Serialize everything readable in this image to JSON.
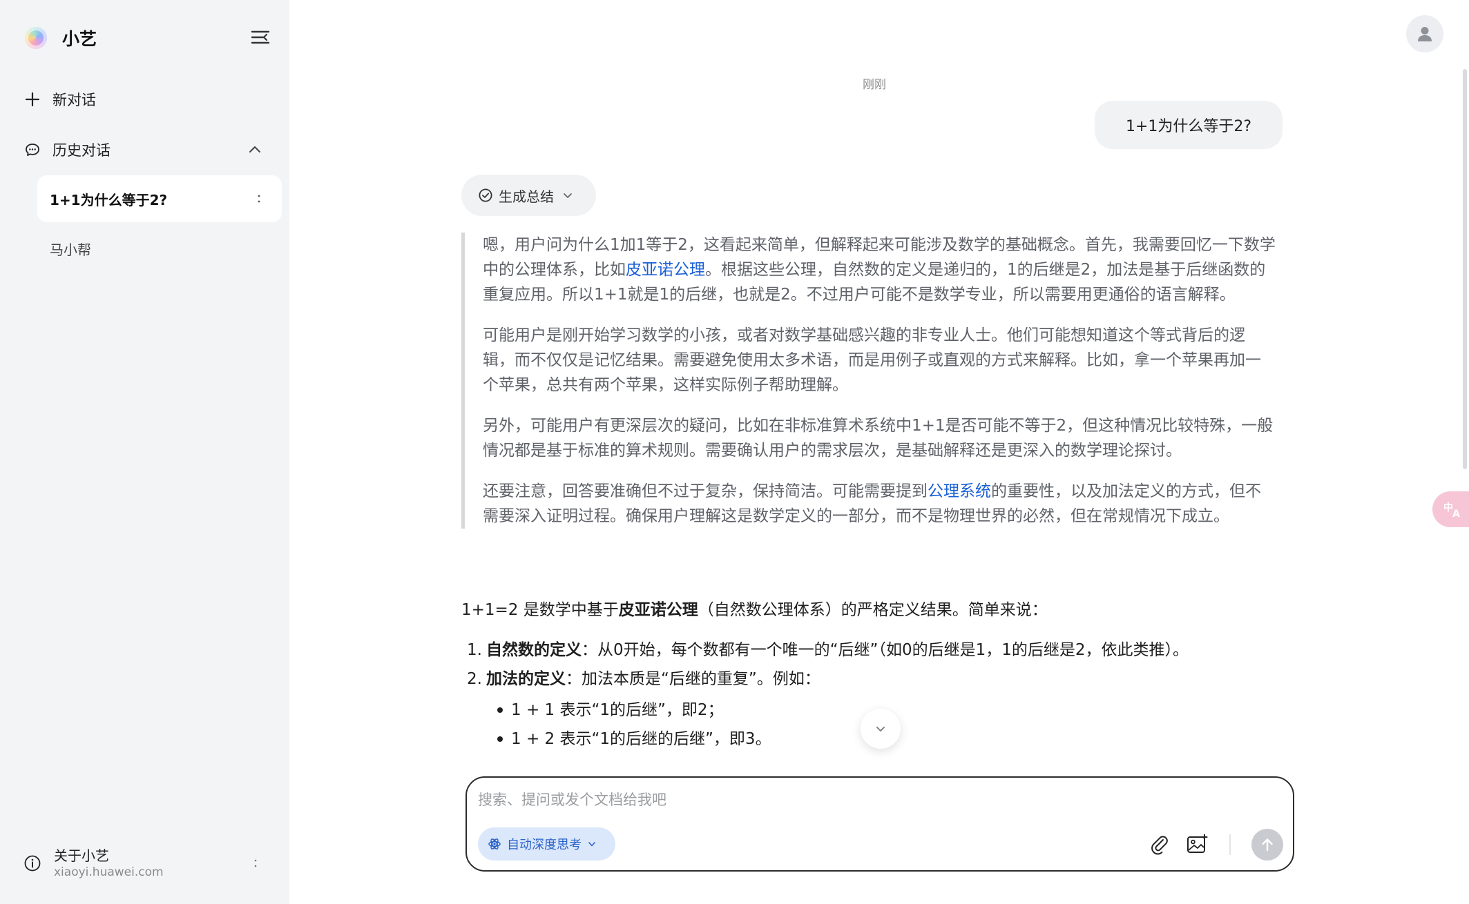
{
  "sidebar": {
    "brand_name": "小艺",
    "new_chat_label": "新对话",
    "history_label": "历史对话",
    "history_items": [
      {
        "title": "1+1为什么等于2?",
        "active": true
      },
      {
        "title": "马小帮",
        "active": false
      }
    ],
    "about_title": "关于小艺",
    "about_url": "xiaoyi.huawei.com"
  },
  "chat": {
    "timestamp": "刚刚",
    "user_message": "1+1为什么等于2?",
    "summary_button_label": "生成总结",
    "thinking": {
      "p1_a": "嗯，用户问为什么1加1等于2，这看起来简单，但解释起来可能涉及数学的基础概念。首先，我需要回忆一下数学中的公理体系，比如",
      "p1_link": "皮亚诺公理",
      "p1_b": "。根据这些公理，自然数的定义是递归的，1的后继是2，加法是基于后继函数的重复应用。所以1+1就是1的后继，也就是2。不过用户可能不是数学专业，所以需要用更通俗的语言解释。",
      "p2": "可能用户是刚开始学习数学的小孩，或者对数学基础感兴趣的非专业人士。他们可能想知道这个等式背后的逻辑，而不仅仅是记忆结果。需要避免使用太多术语，而是用例子或直观的方式来解释。比如，拿一个苹果再加一个苹果，总共有两个苹果，这样实际例子帮助理解。",
      "p3": "另外，可能用户有更深层次的疑问，比如在非标准算术系统中1+1是否可能不等于2，但这种情况比较特殊，一般情况都是基于标准的算术规则。需要确认用户的需求层次，是基础解释还是更深入的数学理论探讨。",
      "p4_a": "还要注意，回答要准确但不过于复杂，保持简洁。可能需要提到",
      "p4_link": "公理系统",
      "p4_b": "的重要性，以及加法定义的方式，但不需要深入证明过程。确保用户理解这是数学定义的一部分，而不是物理世界的必然，但在常规情况下成立。"
    },
    "answer": {
      "intro_a": "1+1=2 是数学中基于",
      "intro_bold": "皮亚诺公理",
      "intro_b": "（自然数公理体系）的严格定义结果。简单来说：",
      "item1_num": "1.",
      "item1_bold": "自然数的定义",
      "item1_text": "：从0开始，每个数都有一个唯一的“后继”（如0的后继是1，1的后继是2，依此类推）。",
      "item2_num": "2.",
      "item2_bold": "加法的定义",
      "item2_text": "：加法本质是“后继的重复”。例如：",
      "bullet1": "1 + 1 表示“1的后继”，即2；",
      "bullet2": "1 + 2 表示“1的后继的后继”，即3。"
    }
  },
  "composer": {
    "placeholder": "搜索、提问或发个文档给我吧",
    "deep_think_label": "自动深度思考"
  },
  "colors": {
    "sidebar_bg": "#f3f4f6",
    "link": "#1a5fd6",
    "deep_think_bg": "#dbe7fb",
    "deep_think_text": "#2a63c8"
  },
  "icons": [
    "brand-logo",
    "sidebar-collapse-icon",
    "plus-icon",
    "chat-bubble-icon",
    "chevron-up-icon",
    "more-vertical-icon",
    "info-icon",
    "user-avatar-icon",
    "translate-icon",
    "check-circle-icon",
    "chevron-down-icon",
    "atom-icon",
    "paperclip-icon",
    "image-icon",
    "arrow-up-icon"
  ]
}
